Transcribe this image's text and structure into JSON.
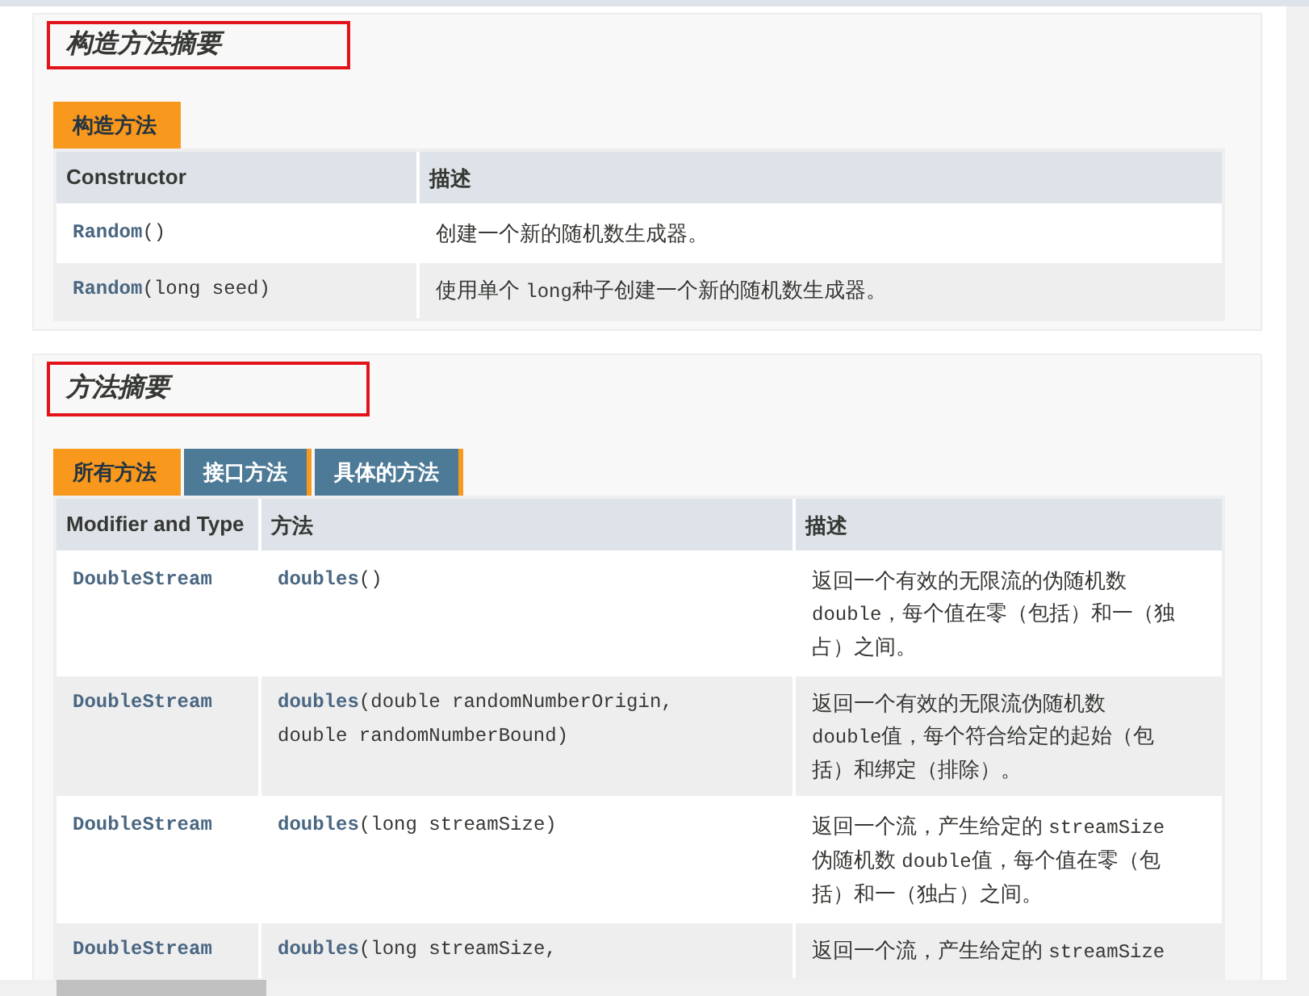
{
  "sections": [
    {
      "heading": "构造方法摘要",
      "tabs": [
        {
          "label": "构造方法",
          "selected": true
        }
      ],
      "columns": [
        "Constructor",
        "描述"
      ],
      "rows": [
        {
          "cells": [
            [
              {
                "text": "Random",
                "kind": "link"
              },
              {
                "text": "()",
                "kind": "code"
              }
            ],
            [
              {
                "text": "创建一个新的随机数生成器。",
                "kind": "text"
              }
            ]
          ]
        },
        {
          "cells": [
            [
              {
                "text": "Random",
                "kind": "link"
              },
              {
                "text": "(long seed)",
                "kind": "code"
              }
            ],
            [
              {
                "text": "使用单个 ",
                "kind": "text"
              },
              {
                "text": "long",
                "kind": "code"
              },
              {
                "text": "种子创建一个新的随机数生成器。",
                "kind": "text"
              }
            ]
          ]
        }
      ]
    },
    {
      "heading": "方法摘要",
      "tabs": [
        {
          "label": "所有方法",
          "selected": true
        },
        {
          "label": "接口方法",
          "selected": false
        },
        {
          "label": "具体的方法",
          "selected": false
        }
      ],
      "columns": [
        "Modifier and Type",
        "方法",
        "描述"
      ],
      "rows": [
        {
          "cells": [
            [
              {
                "text": "DoubleStream",
                "kind": "link"
              }
            ],
            [
              {
                "text": "doubles",
                "kind": "link"
              },
              {
                "text": "()",
                "kind": "code"
              }
            ],
            [
              {
                "text": "返回一个有效的无限流的伪随机数 ",
                "kind": "text"
              },
              {
                "text": "double",
                "kind": "code"
              },
              {
                "text": "，每个值在零（包括）和一（独占）之间。",
                "kind": "text"
              }
            ]
          ]
        },
        {
          "cells": [
            [
              {
                "text": "DoubleStream",
                "kind": "link"
              }
            ],
            [
              {
                "text": "doubles",
                "kind": "link"
              },
              {
                "text": "(double randomNumberOrigin, double randomNumberBound)",
                "kind": "code"
              }
            ],
            [
              {
                "text": "返回一个有效的无限流伪随机数 ",
                "kind": "text"
              },
              {
                "text": "double",
                "kind": "code"
              },
              {
                "text": "值，每个符合给定的起始（包括）和绑定（排除）。",
                "kind": "text"
              }
            ]
          ]
        },
        {
          "cells": [
            [
              {
                "text": "DoubleStream",
                "kind": "link"
              }
            ],
            [
              {
                "text": "doubles",
                "kind": "link"
              },
              {
                "text": "(long streamSize)",
                "kind": "code"
              }
            ],
            [
              {
                "text": "返回一个流，产生给定的 ",
                "kind": "text"
              },
              {
                "text": "streamSize",
                "kind": "code"
              },
              {
                "text": " 伪随机数 ",
                "kind": "text"
              },
              {
                "text": "double",
                "kind": "code"
              },
              {
                "text": "值，每个值在零（包括）和一（独占）之间。",
                "kind": "text"
              }
            ]
          ]
        },
        {
          "cells": [
            [
              {
                "text": "DoubleStream",
                "kind": "link"
              }
            ],
            [
              {
                "text": "doubles",
                "kind": "link"
              },
              {
                "text": "(long streamSize,",
                "kind": "code"
              }
            ],
            [
              {
                "text": "返回一个流，产生给定的 ",
                "kind": "text"
              },
              {
                "text": "streamSize",
                "kind": "code"
              }
            ]
          ]
        }
      ]
    }
  ]
}
